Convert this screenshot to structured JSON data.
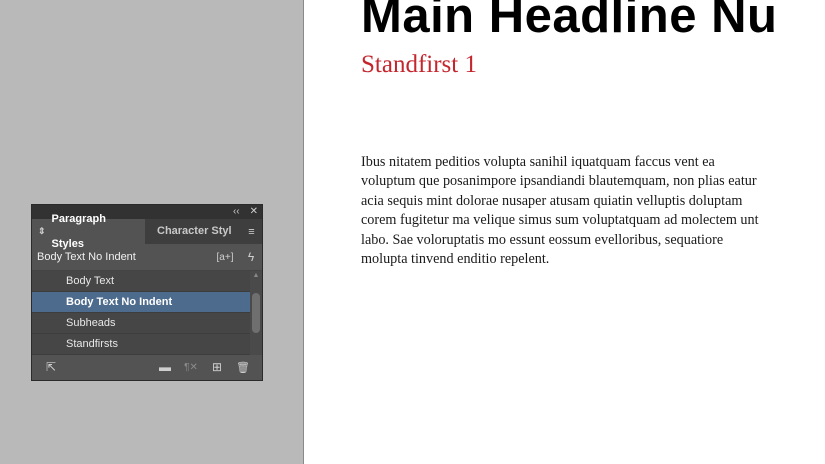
{
  "document": {
    "headline": "Main Headline Nu",
    "standfirst": "Standfirst 1",
    "body": "Ibus nitatem peditios volupta sanihil iquatquam faccus vent ea voluptum que posanimpore ipsandiandi blautemquam, non plias eatur acia sequis mint dolorae nusaper atusam quiatin velluptis doluptam corem fugitetur ma velique simus sum voluptatquam ad molectem unt labo. Sae voloruptatis mo essunt eossum evelloribus, sequatiore molupta tinvend enditio repelent."
  },
  "panel": {
    "topbar": {
      "collapse_glyph": "‹‹",
      "close_glyph": "✕"
    },
    "tabs": [
      {
        "label": "Paragraph Styles",
        "active": true
      },
      {
        "label": "Character Styl",
        "active": false
      }
    ],
    "current_style": "Body Text No Indent",
    "current_icons": {
      "style_overrides": "[a+]",
      "quick_apply": "ϟ"
    },
    "styles": [
      {
        "label": "Body Text",
        "selected": false
      },
      {
        "label": "Body Text No Indent",
        "selected": true
      },
      {
        "label": "Subheads",
        "selected": false
      },
      {
        "label": "Standfirsts",
        "selected": false
      }
    ],
    "icons": {
      "tab_sort": "⇕",
      "tab_menu": "≡",
      "load_styles": "⇱",
      "new_group": "▬",
      "clear_overrides": "¶✕",
      "new_style": "⊞",
      "delete": "🗑"
    },
    "colors": {
      "panel_bg": "#535353",
      "selection": "#4d6b8c",
      "standfirst": "#c4262e"
    }
  }
}
